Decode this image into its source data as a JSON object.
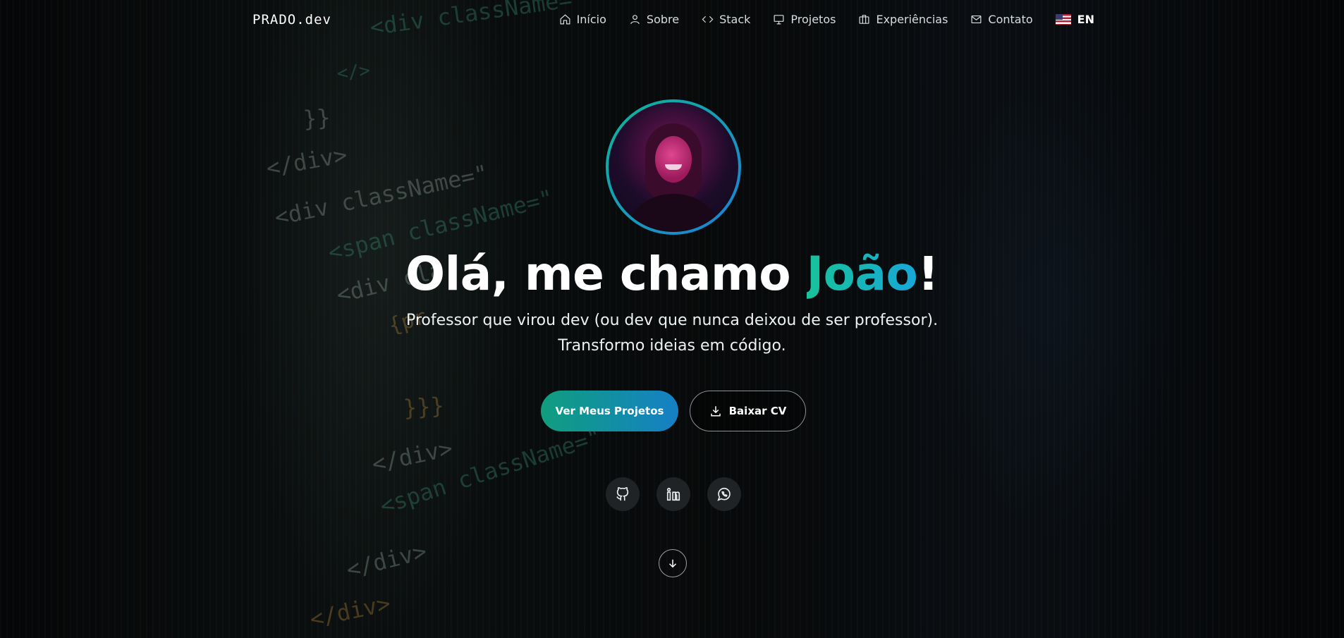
{
  "brand": "PRADO.dev",
  "nav": {
    "items": [
      {
        "label": "Início",
        "icon": "home-icon"
      },
      {
        "label": "Sobre",
        "icon": "user-icon"
      },
      {
        "label": "Stack",
        "icon": "code-icon"
      },
      {
        "label": "Projetos",
        "icon": "monitor-icon"
      },
      {
        "label": "Experiências",
        "icon": "briefcase-icon"
      },
      {
        "label": "Contato",
        "icon": "mail-icon"
      }
    ],
    "language": {
      "label": "EN",
      "icon": "us-flag-icon"
    }
  },
  "hero": {
    "headline_prefix": "Olá, me chamo ",
    "headline_name": "João",
    "headline_suffix": "!",
    "subtitle_line1": "Professor que virou dev (ou dev que nunca deixou de ser professor).",
    "subtitle_line2": "Transformo ideias em código.",
    "primary_button": "Ver Meus Projetos",
    "secondary_button": "Baixar CV"
  },
  "social": [
    {
      "name": "GitHub",
      "icon": "github-icon"
    },
    {
      "name": "LinkedIn",
      "icon": "linkedin-icon"
    },
    {
      "name": "WhatsApp",
      "icon": "whatsapp-icon"
    }
  ],
  "background_code": [
    "<div className=\"",
    "</>",
    "}}",
    "</div>",
    "<div className=\"",
    "<span className=\"",
    "<div cla",
    "{pr",
    "}}}",
    "</div>",
    "<span className=\"",
    "</div>",
    "</div>"
  ],
  "colors": {
    "accent_start": "#0f9e7e",
    "accent_end": "#1580c6",
    "background": "#050607"
  }
}
